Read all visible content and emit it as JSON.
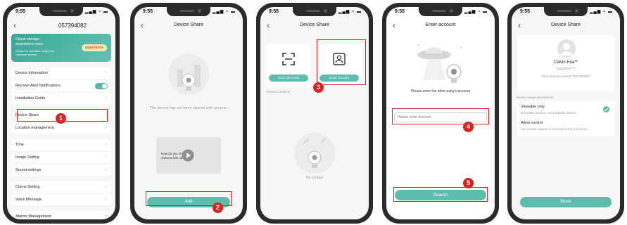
{
  "status_time": "9:55",
  "status_icons": "▂▄▆ ≈ ▬",
  "back_symbol": "‹",
  "chevron": "›",
  "screen1": {
    "title": "057394082",
    "banner": {
      "title": "Cloud storage\nexperience plan",
      "subtitle": "Obtain the activation code from customer service",
      "button": "experience"
    },
    "items": {
      "device_information": "Device Information",
      "receive_alert": "Receive Alert Notifications",
      "installation_guide": "Installation Guide",
      "device_share": "Device Share",
      "location_management": "Location management",
      "time": "Time",
      "image_setting": "Image Setting",
      "sound_settings": "Sound settings",
      "chime_setting": "Chime Setting",
      "voice_message": "Voice Message",
      "alarms_management": "Alarms Management"
    },
    "step": "1"
  },
  "screen2": {
    "title": "Device Share",
    "empty_text": "The device has not been shared with anyone.",
    "video_caption": "How do you share your camera with others?",
    "add_button": "Add",
    "step": "2"
  },
  "screen3": {
    "title": "Device Share",
    "scan_button": "Scan QR Code",
    "enter_button": "Enter account",
    "recent_contacts": "Recent Contacts",
    "no_contact": "No contact",
    "step": "3"
  },
  "screen4": {
    "title": "Enter account",
    "prompt": "Please enter the other party's account",
    "input_placeholder": "Please enter account",
    "search_button": "Search",
    "step_input": "4",
    "step_search": "5"
  },
  "screen5": {
    "title": "Device Share",
    "user_name": "Calvin Hua**",
    "user_phone": "15820001****",
    "sharing_note": "Allow sharing camera \"057394082\"",
    "permissions_heading": "Device usage permissions",
    "viewable_only": "Viewable only",
    "viewable_desc": "Browsable devices, uncontrollable devices",
    "allow_control": "Allow control",
    "allow_desc": "Can browse equipment information and control (sa...",
    "share_button": "Share"
  },
  "colors": {
    "accent": "#5dbdac",
    "highlight": "#e02020"
  }
}
